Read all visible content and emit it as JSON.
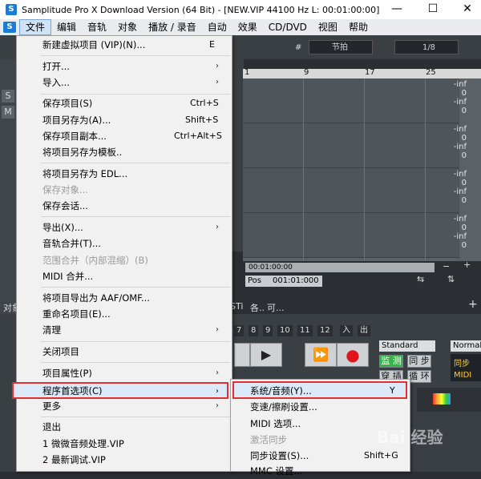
{
  "window": {
    "title": "Samplitude Pro X Download Version (64 Bit) - [NEW.VIP  44100 Hz L: 00:01:00:00]",
    "minimize_glyph": "—",
    "maximize_glyph": "☐",
    "close_glyph": "✕"
  },
  "menubar": {
    "items": [
      "文件",
      "编辑",
      "音轨",
      "对象",
      "播放 / 录音",
      "自动",
      "效果",
      "CD/DVD",
      "视图",
      "帮助"
    ]
  },
  "toolbar": {
    "snap_label": "节拍",
    "quant_label": "1/8"
  },
  "ruler": {
    "ticks": [
      "1",
      "9",
      "17",
      "25"
    ]
  },
  "meters": [
    "-inf",
    "0",
    "-inf",
    "0",
    "-inf",
    "0",
    "-inf",
    "0",
    "-inf",
    "0",
    "-inf",
    "0",
    "-inf",
    "0",
    "-inf",
    "0",
    "-inf",
    "0"
  ],
  "timeline": {
    "time_value": "00:01:00:00",
    "pos_label": "Pos",
    "pos_value": "001:01:000"
  },
  "transport": {
    "track_numbers": [
      "7",
      "8",
      "9",
      "10",
      "11",
      "12"
    ],
    "enter_label": "入",
    "exit_label": "出",
    "play_glyph": "▶",
    "ffwd_glyph": "⏩",
    "record_glyph": "●",
    "standard_label": "Standard",
    "normal_label": "Normal",
    "monitor_label": "监 测",
    "sync_label": "同 步",
    "punch_label": "穿 插",
    "loop_label": "循 环",
    "sync2_label": "同步",
    "midi_label": "MIDI"
  },
  "side_labels": {
    "obj": "对象",
    "sti": "STi",
    "sound": "各..",
    "can": "可..."
  },
  "file_menu": {
    "items": [
      {
        "label": "新建虚拟项目 (VIP)(N)...",
        "shortcut": "E"
      },
      {
        "label": "打开...",
        "arrow": "›"
      },
      {
        "label": "导入...",
        "arrow": "›"
      },
      {
        "label": "保存项目(S)",
        "shortcut": "Ctrl+S"
      },
      {
        "label": "项目另存为(A)...",
        "shortcut": "Shift+S"
      },
      {
        "label": "保存项目副本...",
        "shortcut": "Ctrl+Alt+S"
      },
      {
        "label": "将项目另存为模板.."
      },
      {
        "label": "将项目另存为 EDL..."
      },
      {
        "label": "保存对象...",
        "disabled": true
      },
      {
        "label": "保存会话..."
      },
      {
        "label": "导出(X)...",
        "arrow": "›"
      },
      {
        "label": "音轨合并(T)..."
      },
      {
        "label": "范围合并（内部混缩）(B)",
        "disabled": true
      },
      {
        "label": "MIDI 合并..."
      },
      {
        "label": "将项目导出为 AAF/OMF..."
      },
      {
        "label": "重命名项目(E)..."
      },
      {
        "label": "清理",
        "arrow": "›"
      },
      {
        "label": "关闭项目"
      },
      {
        "label": "项目属性(P)",
        "arrow": "›"
      },
      {
        "label": "程序首选项(C)",
        "arrow": "›",
        "highlighted": true
      },
      {
        "label": "更多",
        "arrow": "›"
      },
      {
        "label": "退出"
      },
      {
        "label": "1 微微音频处理.VIP"
      },
      {
        "label": "2 最新调试.VIP"
      }
    ]
  },
  "pref_submenu": {
    "items": [
      {
        "label": "系统/音频(Y)...",
        "shortcut": "Y",
        "highlighted": true
      },
      {
        "label": "变速/擦刷设置..."
      },
      {
        "label": "MIDI 选项..."
      },
      {
        "label": "激活同步",
        "disabled": true
      },
      {
        "label": "同步设置(S)...",
        "shortcut": "Shift+G"
      },
      {
        "label": "MMC 设置..."
      }
    ]
  },
  "watermark": "Bai 经验"
}
